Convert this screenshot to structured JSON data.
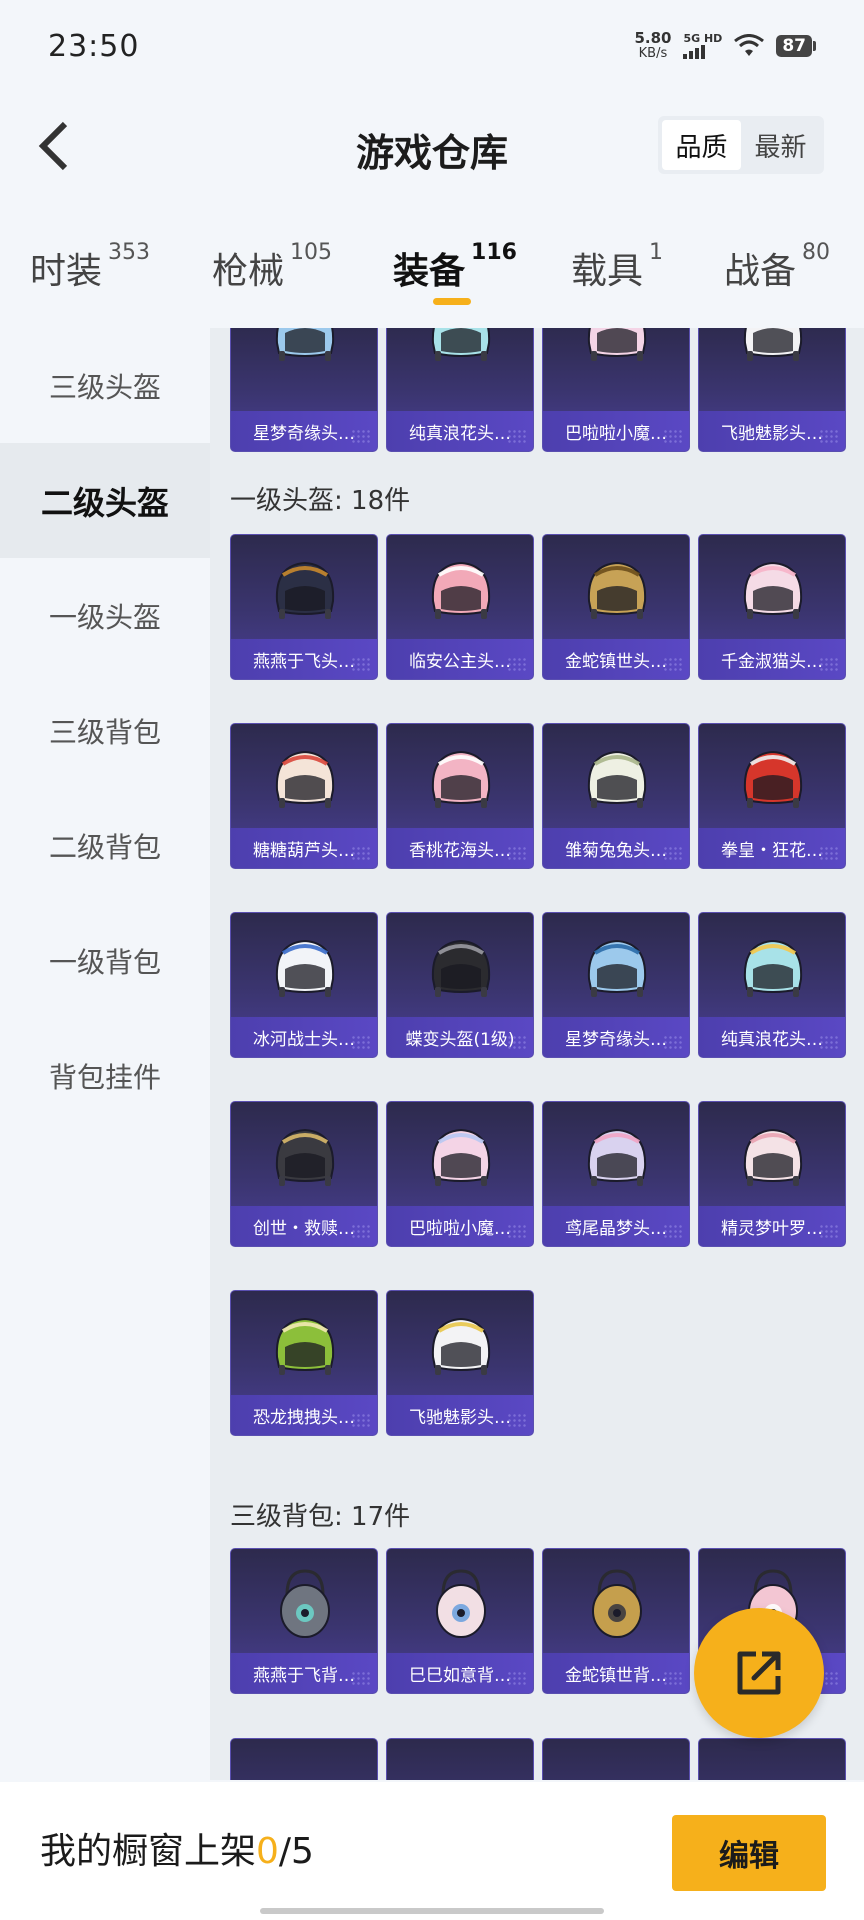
{
  "status_bar": {
    "time": "23:50",
    "net_speed_value": "5.80",
    "net_speed_unit": "KB/s",
    "network_type": "5G HD",
    "battery": "87"
  },
  "header": {
    "title": "游戏仓库",
    "sort_options": [
      "品质",
      "最新"
    ],
    "sort_selected": "品质"
  },
  "tabs": [
    {
      "label": "时装",
      "count": "353"
    },
    {
      "label": "枪械",
      "count": "105"
    },
    {
      "label": "装备",
      "count": "116"
    },
    {
      "label": "载具",
      "count": "1"
    },
    {
      "label": "战备",
      "count": "80"
    }
  ],
  "active_tab": "装备",
  "sidebar": {
    "items": [
      "三级头盔",
      "二级头盔",
      "一级头盔",
      "三级背包",
      "二级背包",
      "一级背包",
      "背包挂件"
    ],
    "active": "二级头盔"
  },
  "content": {
    "prev_row": [
      "星梦奇缘头…",
      "纯真浪花头…",
      "巴啦啦小魔…",
      "飞驰魅影头…"
    ],
    "section1_label": "一级头盔: 18件",
    "section1_items": [
      {
        "name": "燕燕于飞头…",
        "color": "#2b2f45",
        "accent": "#c8882c"
      },
      {
        "name": "临安公主头…",
        "color": "#f2a9b8",
        "accent": "#ffffff"
      },
      {
        "name": "金蛇镇世头…",
        "color": "#c7a256",
        "accent": "#6b4e1c"
      },
      {
        "name": "千金淑猫头…",
        "color": "#f5dbe6",
        "accent": "#f7b3c8"
      },
      {
        "name": "糖糖葫芦头…",
        "color": "#f4e4d8",
        "accent": "#d9463b"
      },
      {
        "name": "香桃花海头…",
        "color": "#f3b4c4",
        "accent": "#ffffff"
      },
      {
        "name": "雏菊兔兔头…",
        "color": "#eef0e3",
        "accent": "#a9b58a"
      },
      {
        "name": "拳皇・狂花…",
        "color": "#d6362b",
        "accent": "#f1f1f1"
      },
      {
        "name": "冰河战士头…",
        "color": "#f2f4f8",
        "accent": "#3a6cc9"
      },
      {
        "name": "蝶变头盔(1级)",
        "color": "#2b2b2f",
        "accent": "#9a9aa2"
      },
      {
        "name": "星梦奇缘头…",
        "color": "#9cc9ec",
        "accent": "#2a6aa8"
      },
      {
        "name": "纯真浪花头…",
        "color": "#a8e2e8",
        "accent": "#f4c84a"
      },
      {
        "name": "创世・救赎…",
        "color": "#3a3a40",
        "accent": "#d9b96a"
      },
      {
        "name": "巴啦啦小魔…",
        "color": "#f4d4e6",
        "accent": "#b8c8f2"
      },
      {
        "name": "鸢尾晶梦头…",
        "color": "#d9d2ef",
        "accent": "#f1a4c4"
      },
      {
        "name": "精灵梦叶罗…",
        "color": "#f4e2e6",
        "accent": "#e9a3b1"
      },
      {
        "name": "恐龙拽拽头…",
        "color": "#8cbf3a",
        "accent": "#f2e9b4"
      },
      {
        "name": "飞驰魅影头…",
        "color": "#f3f3f5",
        "accent": "#e8c64a"
      }
    ],
    "section2_label": "三级背包: 17件",
    "section2_items": [
      {
        "name": "燕燕于飞背…",
        "color": "#6f7580",
        "accent": "#6bd1c8"
      },
      {
        "name": "巳巳如意背…",
        "color": "#f2dfe4",
        "accent": "#6fa2de"
      },
      {
        "name": "金蛇镇世背…",
        "color": "#c59f4d",
        "accent": "#3b3a40"
      },
      {
        "name": "",
        "color": "#f3c6d3",
        "accent": "#ffffff"
      }
    ]
  },
  "bottom_bar": {
    "showcase_label": "我的橱窗上架",
    "showcase_current": "0",
    "showcase_total": "/5",
    "edit_label": "编辑"
  },
  "colors": {
    "accent": "#f6b01b",
    "card_bg": "#3b3570",
    "card_label": "#4d3fae"
  }
}
